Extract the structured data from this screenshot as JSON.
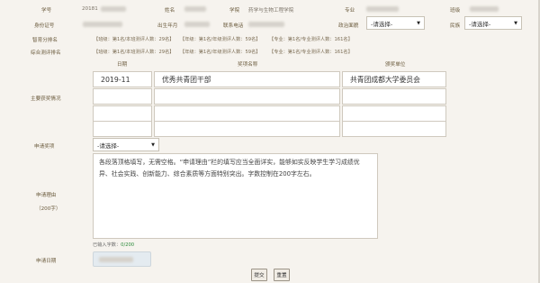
{
  "row1": {
    "student_id_label": "学号",
    "student_id_value": "20181",
    "name_label": "姓名",
    "college_label": "学院",
    "college_value": "药学与生物工程学院",
    "major_label": "专业",
    "class_label": "班级"
  },
  "row2": {
    "id_card_label": "身份证号",
    "birth_label": "出生年月",
    "phone_label": "联系电话",
    "political_label": "政治面貌",
    "political_select": "-请选择-",
    "ethnicity_label": "民族",
    "ethnicity_select": "-请选择-"
  },
  "rank_rows": [
    {
      "label": "智育分排名",
      "class_rank": "【班级：第1名/本班测评人数：29名】",
      "grade_rank": "【年级：第1名/年级测评人数：59名】",
      "major_rank": "【专业：第1名/专业测评人数：161名】"
    },
    {
      "label": "综合测评排名",
      "class_rank": "【班级：第1名/本班测评人数：29名】",
      "grade_rank": "【年级：第1名/年级测评人数：59名】",
      "major_rank": "【专业：第1名/专业测评人数：161名】"
    }
  ],
  "awards": {
    "section_label": "主要获奖情况",
    "col_date": "日期",
    "col_name": "奖项名称",
    "col_org": "颁奖单位",
    "rows": [
      {
        "date": "2019-11",
        "name": "优秀共青团干部",
        "org": "共青团成都大学委员会"
      },
      {
        "date": "",
        "name": "",
        "org": ""
      },
      {
        "date": "",
        "name": "",
        "org": ""
      },
      {
        "date": "",
        "name": "",
        "org": ""
      }
    ]
  },
  "apply": {
    "award_label": "申请奖项",
    "award_select": "-请选择-",
    "reason_label": "申请理由",
    "reason_sub": "（200字）",
    "reason_text": "各段落顶格填写，无需空格。“申请理由”栏的填写应当全面详实，能够如实反映学生学习成绩优异、社会实践、创新能力、综合素质等方面特别突出。字数控制在200字左右。",
    "count_prefix": "已输入字数：",
    "count_value": "0/200",
    "date_label": "申请日期"
  },
  "buttons": {
    "submit": "提交",
    "reset": "重置"
  }
}
